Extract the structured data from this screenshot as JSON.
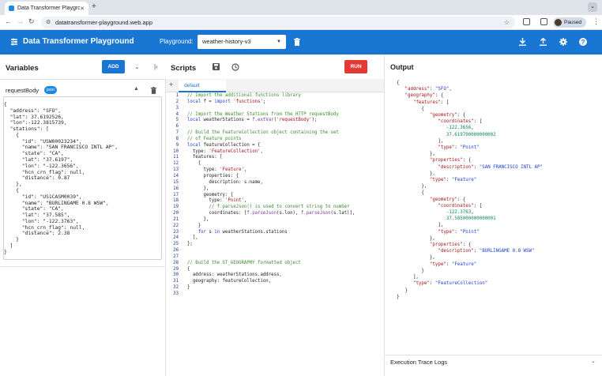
{
  "browser": {
    "tab_title": "Data Transformer Playground",
    "url": "datatransformer-playground.web.app",
    "profile_label": "Paused"
  },
  "app": {
    "title": "Data Transformer Playground",
    "playground_label": "Playground:",
    "playground_value": "weather-history-v3",
    "accent_color": "#1976d2",
    "run_color": "#e53935"
  },
  "variables": {
    "title": "Variables",
    "add_label": "ADD",
    "item_name": "requestBody",
    "item_type": "json",
    "json_lines": [
      "{",
      "  \"address\": \"SFO\",",
      "  \"lat\": 37.6192526,",
      "  \"lon\":-122.3815739,",
      "  \"stations\": [",
      "    {",
      "      \"id\": \"USW00023234\",",
      "      \"name\": \"SAN FRANCISCO INTL AP\",",
      "      \"state\": \"CA\",",
      "      \"lat\": \"37.6197\",",
      "      \"lon\": \"-122.3656\",",
      "      \"hcn_crn_flag\": null,",
      "      \"distance\": 0.87",
      "    },",
      "    {",
      "      \"id\": \"US1CASM0039\",",
      "      \"name\": \"BURLINGAME 0.8 WSW\",",
      "      \"state\": \"CA\",",
      "      \"lat\": \"37.585\",",
      "      \"lon\": \"-122.3763\",",
      "      \"hcn_crn_flag\": null,",
      "      \"distance\": 2.38",
      "    }",
      "  ]",
      "}"
    ]
  },
  "scripts": {
    "title": "Scripts",
    "run_label": "RUN",
    "tab_label": "default",
    "line_numbers": [
      "1",
      "2",
      "3",
      "4",
      "5",
      "6",
      "7",
      "8",
      "9",
      "10",
      "11",
      "12",
      "13",
      "14",
      "15",
      "16",
      "17",
      "18",
      "19",
      "20",
      "21",
      "22",
      "23",
      "24",
      "25",
      "26",
      "27",
      "28",
      "29",
      "30",
      "31",
      "32",
      "33"
    ],
    "code_lines": [
      "// Import the additional functions library",
      "local f = import 'functions';",
      "",
      "// Import the Weather Stations from the HTTP requestBody",
      "local weatherStations = f.extVar('requestBody');",
      "",
      "// Build the FeatureCollection object containing the set",
      "// of Feature points",
      "local featureCollection = {",
      "  type: 'FeatureCollection',",
      "  features: [",
      "    {",
      "      type: 'Feature',",
      "      properties: {",
      "        description: s.name,",
      "      },",
      "      geometry: {",
      "        type: 'Point',",
      "        // f.parseJson() is used to convert string to number",
      "        coordinates: [f.parseJson(s.lon), f.parseJson(s.lat)],",
      "      },",
      "    }",
      "    for s in weatherStations.stations",
      "  ],",
      "};",
      "",
      "",
      "// Build the ST_GEOGRAPHY formatted object",
      "{",
      "  address: weatherStations.address,",
      "  geography: featureCollection,",
      "}",
      ""
    ]
  },
  "output": {
    "title": "Output",
    "json_lines": [
      "{",
      "   \"address\": \"SFO\",",
      "   \"geography\": {",
      "      \"features\": [",
      "         {",
      "            \"geometry\": {",
      "               \"coordinates\": [",
      "                  -122.3656,",
      "                  37.619700000000002",
      "               ],",
      "               \"type\": \"Point\"",
      "            },",
      "            \"properties\": {",
      "               \"description\": \"SAN FRANCISCO INTL AP\"",
      "            },",
      "            \"type\": \"Feature\"",
      "         },",
      "         {",
      "            \"geometry\": {",
      "               \"coordinates\": [",
      "                  -122.3763,",
      "                  37.585000000000001",
      "               ],",
      "               \"type\": \"Point\"",
      "            },",
      "            \"properties\": {",
      "               \"description\": \"BURLINGAME 0.8 WSW\"",
      "            },",
      "            \"type\": \"Feature\"",
      "         }",
      "      ],",
      "      \"type\": \"FeatureCollection\"",
      "   }",
      "}"
    ],
    "trace_label": "Execution Trace Logs"
  }
}
